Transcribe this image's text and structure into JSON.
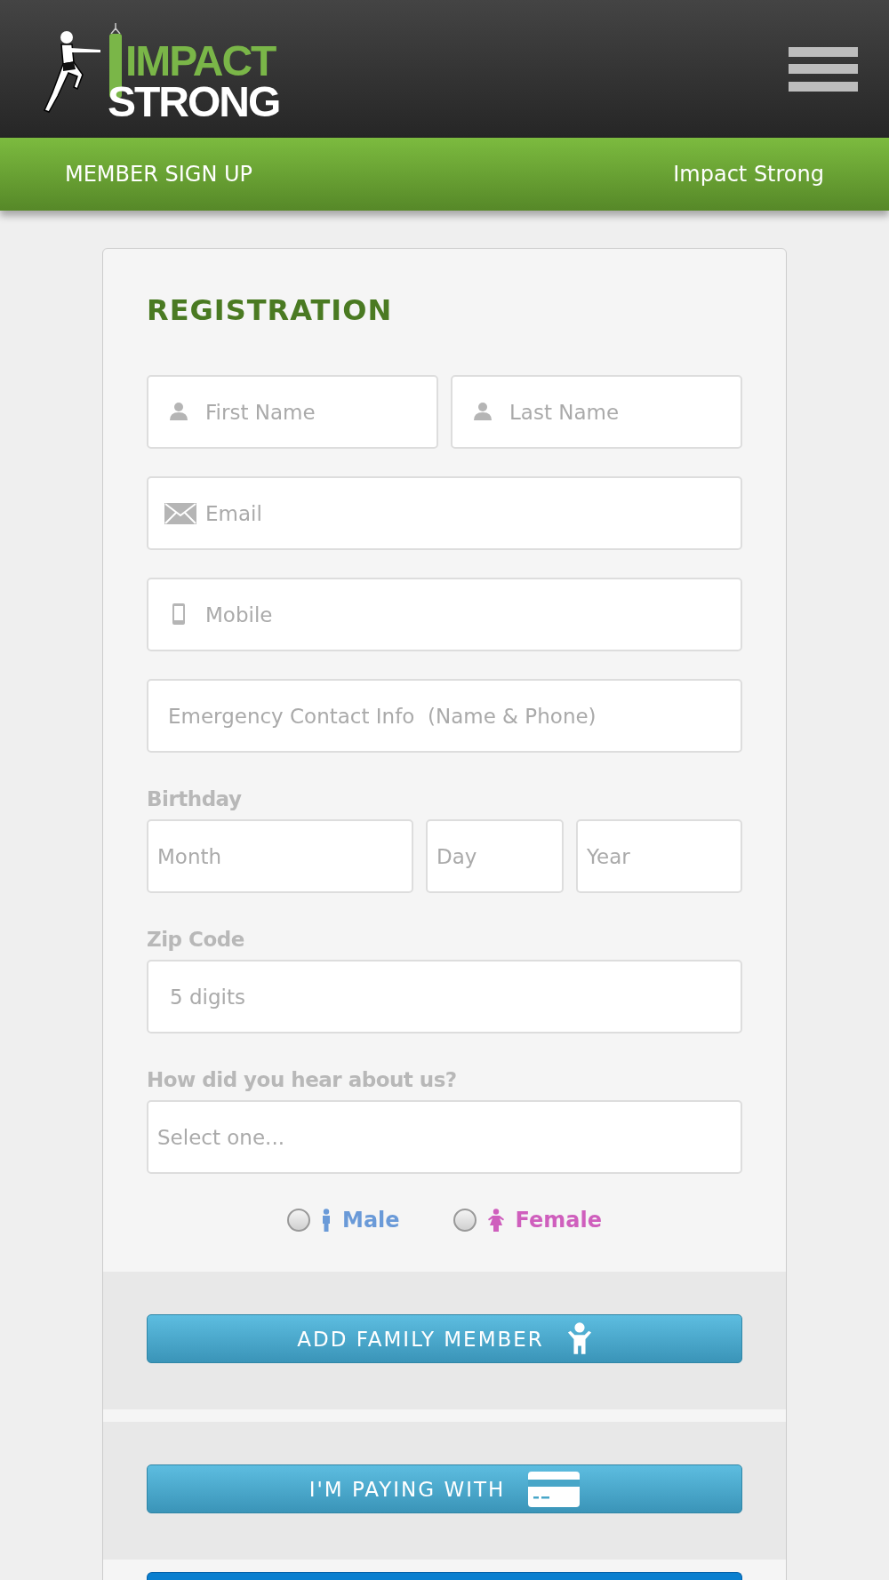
{
  "header": {
    "logo": {
      "top": "IMPACT",
      "bottom": "STRONG"
    }
  },
  "nav_bar": {
    "title": "MEMBER SIGN UP",
    "brand": "Impact Strong"
  },
  "form": {
    "title": "REGISTRATION",
    "name_fields": [
      {
        "placeholder": "First Name",
        "kind": "person"
      },
      {
        "placeholder": "Last Name",
        "kind": "person"
      }
    ],
    "fields": [
      {
        "placeholder": "Email",
        "kind": "mail"
      },
      {
        "placeholder": "Mobile",
        "kind": "phone"
      },
      {
        "placeholder": "Emergency Contact Info  (Name & Phone)",
        "kind": "plain"
      }
    ],
    "birthday": {
      "label": "Birthday",
      "fields": [
        {
          "placeholder": "Month"
        },
        {
          "placeholder": "Day"
        },
        {
          "placeholder": "Year"
        }
      ]
    },
    "zip": {
      "label": "Zip Code",
      "placeholder": "5 digits"
    },
    "referral": {
      "label": "How did you hear about us?",
      "placeholder": "Select one..."
    },
    "gender": [
      {
        "label": "Male",
        "selected": false,
        "color": "#6a9ad8",
        "kind": "male"
      },
      {
        "label": "Female",
        "selected": false,
        "color": "#cf5fbd",
        "kind": "female"
      }
    ],
    "buttons": [
      {
        "label": "ADD FAMILY MEMBER",
        "kind": "family"
      },
      {
        "label": "I'M PAYING WITH",
        "kind": "payment"
      }
    ]
  }
}
